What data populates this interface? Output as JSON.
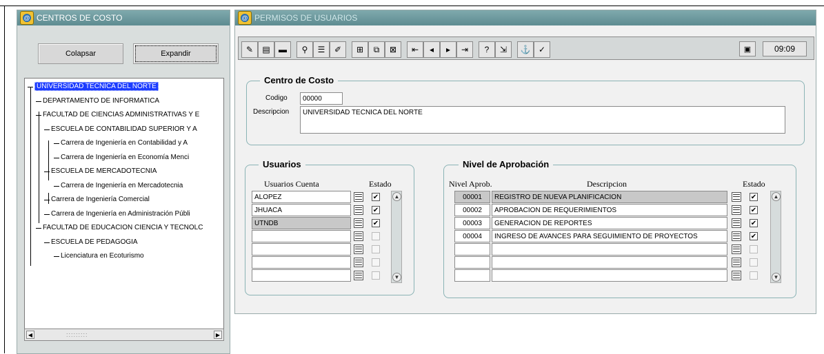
{
  "left_window": {
    "title": "CENTROS DE COSTO",
    "collapse_label": "Colapsar",
    "expand_label": "Expandir",
    "tree": [
      {
        "label": "UNIVERSIDAD TECNICA DEL NORTE",
        "level": 0,
        "selected": true
      },
      {
        "label": "DEPARTAMENTO DE INFORMATICA",
        "level": 1
      },
      {
        "label": "FACULTAD DE CIENCIAS ADMINISTRATIVAS Y E",
        "level": 1
      },
      {
        "label": "ESCUELA DE CONTABILIDAD SUPERIOR Y A",
        "level": 2
      },
      {
        "label": "Carrera de Ingeniería en Contabilidad y A",
        "level": 3
      },
      {
        "label": "Carrera de Ingeniería en Economía Menci",
        "level": 3
      },
      {
        "label": "ESCUELA DE MERCADOTECNIA",
        "level": 2
      },
      {
        "label": "Carrera de Ingeniería en Mercadotecnia",
        "level": 3
      },
      {
        "label": "Carrera de Ingeniería Comercial",
        "level": 2
      },
      {
        "label": "Carrera de Ingeniería en Administración Públi",
        "level": 2
      },
      {
        "label": "FACULTAD DE EDUCACION CIENCIA Y TECNOLC",
        "level": 1
      },
      {
        "label": "ESCUELA DE PEDAGOGIA",
        "level": 2
      },
      {
        "label": "Licenciatura en Ecoturismo",
        "level": 3
      }
    ],
    "scroll_thumb": ":::::::::"
  },
  "main_window": {
    "title": "PERMISOS DE USUARIOS",
    "clock": "09:09",
    "toolbar_icons": [
      "clear-icon",
      "save-icon",
      "print-icon",
      "query-icon",
      "list-icon",
      "edit-icon",
      "insert-record-icon",
      "duplicate-record-icon",
      "delete-record-icon",
      "first-record-icon",
      "previous-record-icon",
      "next-record-icon",
      "last-record-icon",
      "help-icon",
      "exit-icon",
      "key-icon",
      "check-icon"
    ],
    "centro": {
      "legend": "Centro de Costo",
      "codigo_label": "Codigo",
      "codigo_value": "00000",
      "descripcion_label": "Descripcion",
      "descripcion_value": "UNIVERSIDAD TECNICA DEL NORTE"
    },
    "usuarios": {
      "legend": "Usuarios",
      "col_cuenta": "Usuarios Cuenta",
      "col_estado": "Estado",
      "rows": [
        {
          "cuenta": "ALOPEZ",
          "estado": true
        },
        {
          "cuenta": "JHUACA",
          "estado": true
        },
        {
          "cuenta": "UTNDB",
          "estado": true
        },
        {
          "cuenta": "",
          "estado": false
        },
        {
          "cuenta": "",
          "estado": false
        },
        {
          "cuenta": "",
          "estado": false
        },
        {
          "cuenta": "",
          "estado": false
        }
      ]
    },
    "nivel": {
      "legend": "Nivel de Aprobación",
      "col_nivel": "Nivel Aprob.",
      "col_desc": "Descripcion",
      "col_estado": "Estado",
      "rows": [
        {
          "nivel": "00001",
          "desc": "REGISTRO DE NUEVA PLANIFICACION",
          "estado": true
        },
        {
          "nivel": "00002",
          "desc": "APROBACION DE REQUERIMIENTOS",
          "estado": true
        },
        {
          "nivel": "00003",
          "desc": "GENERACION DE REPORTES",
          "estado": true
        },
        {
          "nivel": "00004",
          "desc": "INGRESO DE AVANCES PARA SEGUIMIENTO DE PROYECTOS",
          "estado": true
        },
        {
          "nivel": "",
          "desc": "",
          "estado": false
        },
        {
          "nivel": "",
          "desc": "",
          "estado": false
        },
        {
          "nivel": "",
          "desc": "",
          "estado": false
        }
      ]
    }
  }
}
